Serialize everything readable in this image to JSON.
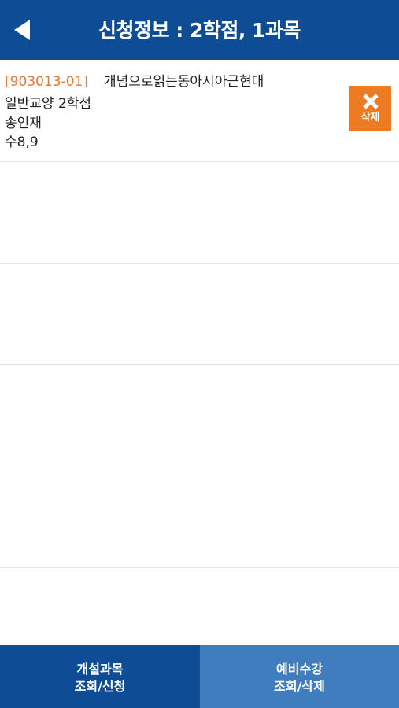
{
  "header": {
    "title": "신청정보 : 2학점,  1과목",
    "back_icon": "back-arrow-icon"
  },
  "courses": [
    {
      "code": "[903013-01]",
      "name": "개념으로읽는동아시아근현대",
      "category": "일반교양 2학점",
      "professor": "송인재",
      "schedule": "수8,9",
      "delete_label": "삭제",
      "delete_icon": "close-icon"
    }
  ],
  "tabs": [
    {
      "line1": "개설과목",
      "line2": "조회/신청"
    },
    {
      "line1": "예비수강",
      "line2": "조회/삭제"
    }
  ],
  "colors": {
    "header_bg": "#0f4c96",
    "tab_left_bg": "#0f4c96",
    "tab_right_bg": "#3f7dbe",
    "code_text": "#e07a3a",
    "delete_bg": "#ee7b21"
  }
}
